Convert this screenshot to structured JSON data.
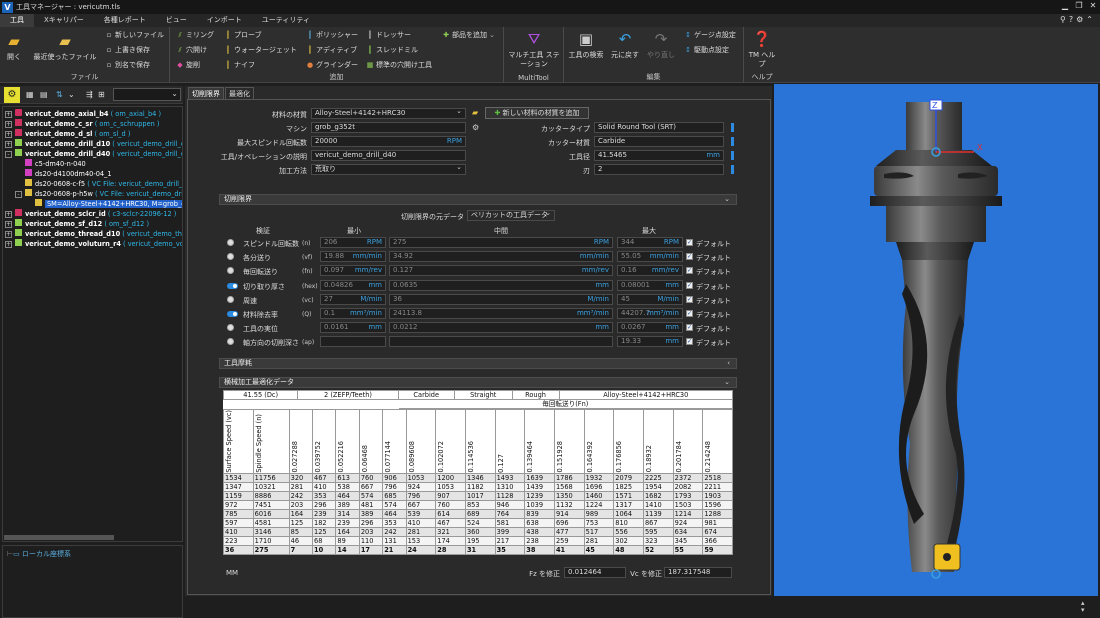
{
  "window": {
    "title": "工具マネージャー : vericutm.tls"
  },
  "menu": {
    "items": [
      "工具",
      "Xキャリパー",
      "各種レポート",
      "ビュー",
      "インポート",
      "ユーティリティ"
    ]
  },
  "ribbon": {
    "file": {
      "label": "ファイル",
      "open": "開く",
      "recent": "最近使ったファイル",
      "new": "新しいファイル",
      "save": "上書き保存",
      "saveas": "別名で保存"
    },
    "add": {
      "label": "追加",
      "milling": "ミリング",
      "drilling": "穴開け",
      "turning": "旋削",
      "probe": "プローブ",
      "waterjet": "ウォータージェット",
      "knife": "ナイフ",
      "polisher": "ポリッシャー",
      "additive": "アディティブ",
      "grinder": "グラインダー",
      "dresser": "ドレッサー",
      "sled": "スレッドミル",
      "stdhole": "標準の穴開け工具",
      "addpart": "部品を追加"
    },
    "multitool": {
      "label": "MultiTool",
      "station": "マルチ工具 ステーション"
    },
    "edit": {
      "label": "編集",
      "search": "工具の検索",
      "undo": "元に戻す",
      "redo": "やり直し",
      "gauge": "ゲージ点設定",
      "drive": "駆動点設定"
    },
    "help": {
      "label": "ヘルプ",
      "tmhelp": "TM ヘルプ"
    }
  },
  "tree": [
    {
      "pm": "+",
      "name": "vericut_demo_axial_b4",
      "comment": "( om_axial_b4 )"
    },
    {
      "pm": "+",
      "name": "vericut_demo_c_sr",
      "comment": "( om_c_schruppen )"
    },
    {
      "pm": "+",
      "name": "vericut_demo_d_sl",
      "comment": "( om_sl_d )"
    },
    {
      "pm": "+",
      "name": "vericut_demo_drill_d10",
      "comment": "( vericut_demo_drill_d1"
    },
    {
      "pm": "-",
      "name": "vericut_demo_drill_d40",
      "comment": "( vericut_demo_drill_d4"
    },
    {
      "pm": "",
      "name": "c5-dm40-n-040",
      "comment": ""
    },
    {
      "pm": "",
      "name": "ds20-d4100dm40-04_1",
      "comment": ""
    },
    {
      "pm": "",
      "name": "ds20-0608-c-f5",
      "comment": "( VC File: vericut_demo_drill_d"
    },
    {
      "pm": "-",
      "name": "ds20-0608-p-h5w",
      "comment": "( VC File: vericut_demo_drill_"
    },
    {
      "pm": "",
      "name": "SM=Alloy-Steel+4142+HRC30, M=grob_g3",
      "comment": ""
    },
    {
      "pm": "+",
      "name": "vericut_demo_sclcr_id",
      "comment": "( c3-sclcr-22096-12 )"
    },
    {
      "pm": "+",
      "name": "vericut_demo_sf_d12",
      "comment": "( om_sf_d12 )"
    },
    {
      "pm": "+",
      "name": "vericut_demo_thread_d10",
      "comment": "( vericut_demo_threa"
    },
    {
      "pm": "+",
      "name": "vericut_demo_voluturn_r4",
      "comment": "( vericut_demo_volut"
    }
  ],
  "lower": {
    "label": "ローカル座標系"
  },
  "tabs": [
    "切削限界",
    "最適化"
  ],
  "form": {
    "material_label": "材料の材質",
    "material": "Alloy-Steel+4142+HRC30",
    "add_material": "新しい材料の材質を追加",
    "machine_label": "マシン",
    "machine": "grob_g352t",
    "spindle_label": "最大スピンドル回転数",
    "spindle": "20000",
    "spindle_unit": "RPM",
    "desc_label": "工具/オペレーションの説明",
    "desc": "vericut_demo_drill_d40",
    "method_label": "加工方法",
    "method": "荒取り",
    "cuttype_label": "カッタータイプ",
    "cuttype": "Solid Round Tool (SRT)",
    "cutmat_label": "カッター材質",
    "cutmat": "Carbide",
    "dia_label": "工具径",
    "dia": "41.5465",
    "dia_unit": "mm",
    "flutes_label": "刃",
    "flutes": "2"
  },
  "limits": {
    "section": "切削限界",
    "source_label": "切削限界の元データ",
    "source": "ベリカットの工具データ",
    "hdr_verify": "検証",
    "hdr_min": "最小",
    "hdr_mid": "中間",
    "hdr_max": "最大",
    "default": "デフォルト",
    "rows": [
      {
        "ctl": "radio",
        "name": "スピンドル回転数",
        "sym": "(n)",
        "min": "206",
        "min_u": "RPM",
        "mid": "275",
        "mid_u": "RPM",
        "max": "344",
        "max_u": "RPM"
      },
      {
        "ctl": "radio",
        "name": "各分送り",
        "sym": "(vf)",
        "min": "19.88",
        "min_u": "mm/min",
        "mid": "34.92",
        "mid_u": "mm/min",
        "max": "55.05",
        "max_u": "mm/min"
      },
      {
        "ctl": "radio",
        "name": "毎回転送り",
        "sym": "(fn)",
        "min": "0.097",
        "min_u": "mm/rev",
        "mid": "0.127",
        "mid_u": "mm/rev",
        "max": "0.16",
        "max_u": "mm/rev"
      },
      {
        "ctl": "toggle",
        "name": "切り取り厚さ",
        "sym": "(hex)",
        "min": "0.04826",
        "min_u": "mm",
        "mid": "0.0635",
        "mid_u": "mm",
        "max": "0.08001",
        "max_u": "mm"
      },
      {
        "ctl": "radio",
        "name": "周速",
        "sym": "(vc)",
        "min": "27",
        "min_u": "M/min",
        "mid": "36",
        "mid_u": "M/min",
        "max": "45",
        "max_u": "M/min"
      },
      {
        "ctl": "toggle",
        "name": "材料除去率",
        "sym": "(Q)",
        "min": "0.1",
        "min_u": "mm³/min",
        "mid": "24113.8",
        "mid_u": "mm³/min",
        "max": "44207.7",
        "max_u": "mm³/min"
      },
      {
        "ctl": "radio",
        "name": "工具の実位",
        "sym": "",
        "min": "0.0161",
        "min_u": "mm",
        "mid": "0.0212",
        "mid_u": "mm",
        "max": "0.0267",
        "max_u": "mm"
      },
      {
        "ctl": "radio",
        "name": "軸方向の切削深さ",
        "sym": "(ap)",
        "min": "",
        "min_u": "",
        "mid": "",
        "mid_u": "",
        "max": "19.33",
        "max_u": "mm"
      }
    ]
  },
  "wear": {
    "section": "工具摩耗"
  },
  "opt": {
    "section": "横械加工最適化データ",
    "top": [
      "41.55 (Dc)",
      "2 (ZEFP/Teeth)",
      "Carbide",
      "Straight",
      "Rough",
      "Alloy-Steel+4142+HRC30"
    ],
    "fn_label": "毎回転送り(Fn)",
    "cols": [
      "Surface Speed (vc)",
      "Spindle Speed (n)",
      "0.027288",
      "0.039752",
      "0.052216",
      "0.06468",
      "0.077144",
      "0.089608",
      "0.102072",
      "0.114536",
      "0.127",
      "0.139464",
      "0.151928",
      "0.164392",
      "0.176856",
      "0.18932",
      "0.201784",
      "0.214248"
    ],
    "rows": [
      [
        "1534",
        "11756",
        "320",
        "467",
        "613",
        "760",
        "906",
        "1053",
        "1200",
        "1346",
        "1493",
        "1639",
        "1786",
        "1932",
        "2079",
        "2225",
        "2372",
        "2518"
      ],
      [
        "1347",
        "10321",
        "281",
        "410",
        "538",
        "667",
        "796",
        "924",
        "1053",
        "1182",
        "1310",
        "1439",
        "1568",
        "1696",
        "1825",
        "1954",
        "2082",
        "2211"
      ],
      [
        "1159",
        "8886",
        "242",
        "353",
        "464",
        "574",
        "685",
        "796",
        "907",
        "1017",
        "1128",
        "1239",
        "1350",
        "1460",
        "1571",
        "1682",
        "1793",
        "1903"
      ],
      [
        "972",
        "7451",
        "203",
        "296",
        "389",
        "481",
        "574",
        "667",
        "760",
        "853",
        "946",
        "1039",
        "1132",
        "1224",
        "1317",
        "1410",
        "1503",
        "1596"
      ],
      [
        "785",
        "6016",
        "164",
        "239",
        "314",
        "389",
        "464",
        "539",
        "614",
        "689",
        "764",
        "839",
        "914",
        "989",
        "1064",
        "1139",
        "1214",
        "1288"
      ],
      [
        "597",
        "4581",
        "125",
        "182",
        "239",
        "296",
        "353",
        "410",
        "467",
        "524",
        "581",
        "638",
        "696",
        "753",
        "810",
        "867",
        "924",
        "981"
      ],
      [
        "410",
        "3146",
        "85",
        "125",
        "164",
        "203",
        "242",
        "281",
        "321",
        "360",
        "399",
        "438",
        "477",
        "517",
        "556",
        "595",
        "634",
        "674"
      ],
      [
        "223",
        "1710",
        "46",
        "68",
        "89",
        "110",
        "131",
        "153",
        "174",
        "195",
        "217",
        "238",
        "259",
        "281",
        "302",
        "323",
        "345",
        "366"
      ],
      [
        "36",
        "275",
        "7",
        "10",
        "14",
        "17",
        "21",
        "24",
        "28",
        "31",
        "35",
        "38",
        "41",
        "45",
        "48",
        "52",
        "55",
        "59"
      ]
    ],
    "unit": "MM",
    "fz_label": "Fz を修正",
    "fz": "0.012464",
    "vc_label": "Vc を修正",
    "vc": "187.317548"
  },
  "viewport": {
    "axis_z": "Z",
    "axis_x": "X"
  }
}
